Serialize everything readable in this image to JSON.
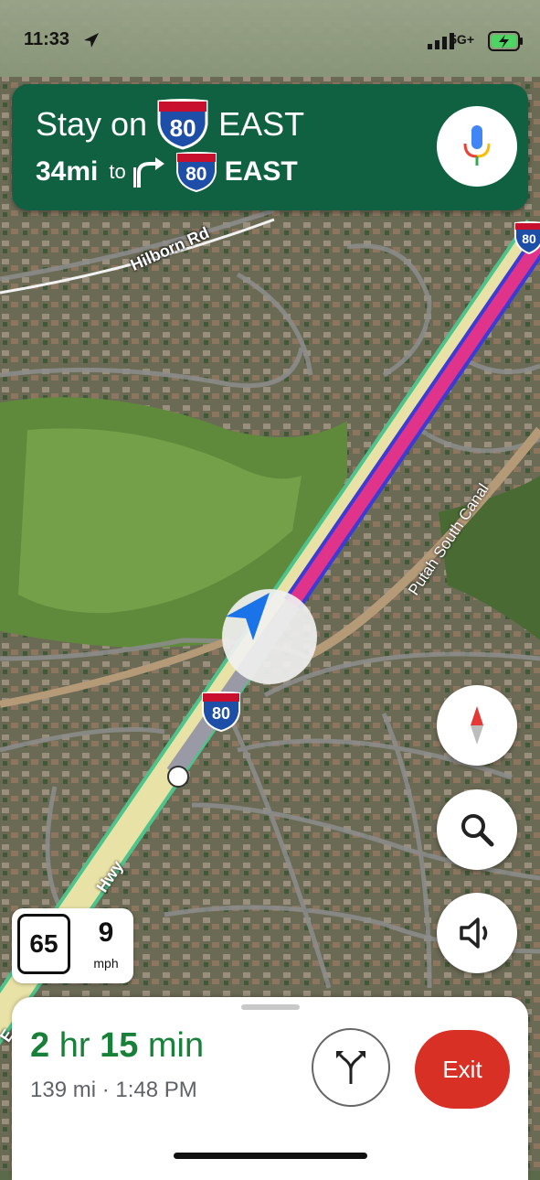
{
  "status_bar": {
    "time": "11:33",
    "network": "5G+"
  },
  "banner": {
    "instruction_prefix": "Stay on",
    "route_shield": "80",
    "direction": "EAST",
    "distance": "34mi",
    "to_label": "to",
    "next_shield": "80",
    "next_direction": "EAST",
    "bg_color": "#0f6141"
  },
  "map": {
    "labels": {
      "road_hilborn": "Hilborn Rd",
      "canal": "Putah South Canal",
      "freeway": "Hwy",
      "freeway_prefix": "E",
      "highway_shield_top": "80",
      "highway_shield_mid": "80"
    },
    "route_color": "#e0338a"
  },
  "controls": {
    "compass": "compass-icon",
    "search": "search-icon",
    "sound": "sound-icon"
  },
  "speed": {
    "limit": "65",
    "current": "9",
    "unit": "mph"
  },
  "trip": {
    "eta_hr": "2",
    "eta_hr_label": "hr",
    "eta_min": "15",
    "eta_min_label": "min",
    "distance_arrival": "139 mi · 1:48 PM",
    "exit_label": "Exit"
  }
}
